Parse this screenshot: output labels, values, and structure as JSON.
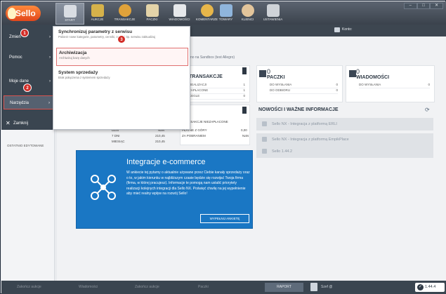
{
  "app": {
    "logo_text": "Sello"
  },
  "toolbar": {
    "items": [
      {
        "label": "START",
        "icon": "home-icon"
      },
      {
        "label": "AUKCJE",
        "icon": "gavel-icon"
      },
      {
        "label": "TRANSAKCJE",
        "icon": "transactions-icon"
      },
      {
        "label": "PACZKI",
        "icon": "packages-icon"
      },
      {
        "label": "WIADOMOŚCI",
        "icon": "messages-icon"
      },
      {
        "label": "KOMENTARZE",
        "icon": "comments-icon"
      },
      {
        "label": "TOWARY",
        "icon": "goods-icon"
      },
      {
        "label": "KLIENCI",
        "icon": "clients-icon"
      },
      {
        "label": "USTAWIENIA",
        "icon": "settings-icon"
      }
    ],
    "window_controls": [
      "–",
      "□",
      "✕"
    ]
  },
  "header": {
    "konto_label": "Konto:"
  },
  "sidebar": {
    "items": [
      {
        "label": "Zmień"
      },
      {
        "label": "Pomoc"
      },
      {
        "label": "Moje dane"
      },
      {
        "label": "Narzędzia"
      },
      {
        "label": "Zamknij"
      }
    ],
    "recently_edited": "OSTATNIO EDYTOWANE"
  },
  "popup": {
    "items": [
      {
        "title": "Synchronizuj parametry z serwisu",
        "desc": "Pobierz nowe kategorie, parametry, cenniki, cenniki itp. serwisu zaktualizuj"
      },
      {
        "title": "Archiwizacja",
        "desc": "Archiwizuj bazę danych"
      },
      {
        "title": "System sprzedaży",
        "desc": "Brak połączenia z systemem sprzedaży"
      }
    ]
  },
  "badges": [
    "1",
    "2",
    "3"
  ],
  "main": {
    "sandbox_note": "...ono na Sandbox (test Allegro)",
    "transakcje": {
      "title": "TRANSAKCJE",
      "rows": [
        {
          "label": "REALIZACJI",
          "value": "1"
        },
        {
          "label": "ZAPŁACONE",
          "value": "1"
        },
        {
          "label": "CEGLE",
          "value": "0"
        }
      ]
    },
    "paczki": {
      "num": "0",
      "title": "PACZKI",
      "rows": [
        {
          "label": "DO WYSŁANIA",
          "value": "0"
        },
        {
          "label": "DO ODBIORU",
          "value": "0"
        }
      ]
    },
    "wiadomosci": {
      "num": "0",
      "title": "WIADOMOŚCI",
      "rows": [
        {
          "label": "DO WYSŁANIA",
          "value": "0"
        }
      ]
    },
    "sales": {
      "header_right": "TRANSAKCJE NIEZAPŁACONE",
      "rows": [
        {
          "label": "DZIŚ",
          "value": "NaN",
          "label2": "PŁATNE Z GÓRY",
          "value2": "0,00"
        },
        {
          "label": "7 DNI",
          "value": "210,45",
          "label2": "ZA POBRANIEM",
          "value2": "NaN"
        },
        {
          "label": "MIESIĄC",
          "value": "210,45",
          "label2": "",
          "value2": ""
        }
      ]
    },
    "promo": {
      "title": "Integracje e-commerce",
      "text": "W ankiecie tej pytamy o aktualnie używane przez Ciebie kanały sprzedaży oraz o to, w jakim kierunku w najbliższym czasie będzie się rozwijać Twoja firma (firma, w której pracujesz). Informacje te pomogą nam ustalić priorytety realizacji kolejnych integracji dla Sello NX. Poświęć chwilę na jej wypełnienie aby mieć realny wpływ na rozwój Sello!",
      "button": "WYPEŁNIJ ANKIETĘ"
    },
    "news": {
      "title": "NOWOŚCI I WAŻNE INFORMACJE",
      "items": [
        "Sello NX - Integracja z platformą ERLI",
        "Sello NX - Integracja z platformą EmpikPlace",
        "Sello 1.44.2"
      ]
    }
  },
  "statusbar": {
    "faded": [
      "Zakończ aukcje",
      "Wiadomości",
      "Zakończ aukcje",
      "Paczki"
    ],
    "raport": "RAPORT",
    "szef": "Szef @",
    "version": "1.44.4"
  }
}
